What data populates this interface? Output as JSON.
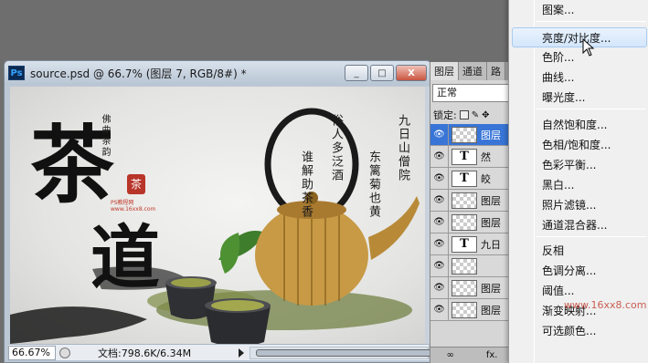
{
  "document": {
    "title": "source.psd @ 66.7% (图层 7, RGB/8#) *",
    "ps_badge": "Ps",
    "window_buttons": [
      "_",
      "□",
      "X"
    ],
    "zoom": "66.67%",
    "doc_size": "文档:798.6K/6.34M"
  },
  "artwork": {
    "big_char_1": "茶",
    "big_char_2": "道",
    "poem_col_1": "九日山僧院",
    "poem_col_2": "东篱菊也黄",
    "poem_col_3": "俗人多泛酒",
    "poem_col_4": "谁解助茶香",
    "small_signature": "佛曲茶韵",
    "watermark_text": "PS教程网 www.16xx8.com",
    "seal_char": "茶"
  },
  "layers_panel": {
    "tabs": [
      "图层",
      "通道",
      "路"
    ],
    "blend_mode": "正常",
    "lock_label": "锁定:",
    "layers": [
      {
        "type": "pixel",
        "name": "图层",
        "selected": true
      },
      {
        "type": "text",
        "name": "然",
        "selected": false
      },
      {
        "type": "text",
        "name": "皎",
        "selected": false
      },
      {
        "type": "pixel",
        "name": "图层",
        "selected": false
      },
      {
        "type": "pixel",
        "name": "图层",
        "selected": false
      },
      {
        "type": "text",
        "name": "九日",
        "selected": false
      },
      {
        "type": "mask",
        "name": "",
        "selected": false
      },
      {
        "type": "pixel",
        "name": "图层",
        "selected": false
      },
      {
        "type": "pixel",
        "name": "图层",
        "selected": false
      }
    ],
    "text_thumb_glyph": "T",
    "eye_glyph": "👁",
    "footer_fx": "fx."
  },
  "menu": {
    "items": [
      {
        "label": "图案...",
        "highlighted": false
      },
      {
        "label": "亮度/对比度...",
        "highlighted": true
      },
      {
        "label": "色阶...",
        "highlighted": false
      },
      {
        "label": "曲线...",
        "highlighted": false
      },
      {
        "label": "曝光度...",
        "highlighted": false
      },
      {
        "label": "自然饱和度...",
        "highlighted": false
      },
      {
        "label": "色相/饱和度...",
        "highlighted": false
      },
      {
        "label": "色彩平衡...",
        "highlighted": false
      },
      {
        "label": "黑白...",
        "highlighted": false
      },
      {
        "label": "照片滤镜...",
        "highlighted": false
      },
      {
        "label": "通道混合器...",
        "highlighted": false
      },
      {
        "label": "反相",
        "highlighted": false
      },
      {
        "label": "色调分离...",
        "highlighted": false
      },
      {
        "label": "阈值...",
        "highlighted": false
      },
      {
        "label": "渐变映射...",
        "highlighted": false
      },
      {
        "label": "可选颜色...",
        "highlighted": false
      }
    ],
    "overlay_watermark": "www.16xx8.com"
  },
  "colors": {
    "selected_layer": "#3875d7",
    "menu_highlight": "#d3e6fb",
    "seal_red": "#c0392b"
  }
}
